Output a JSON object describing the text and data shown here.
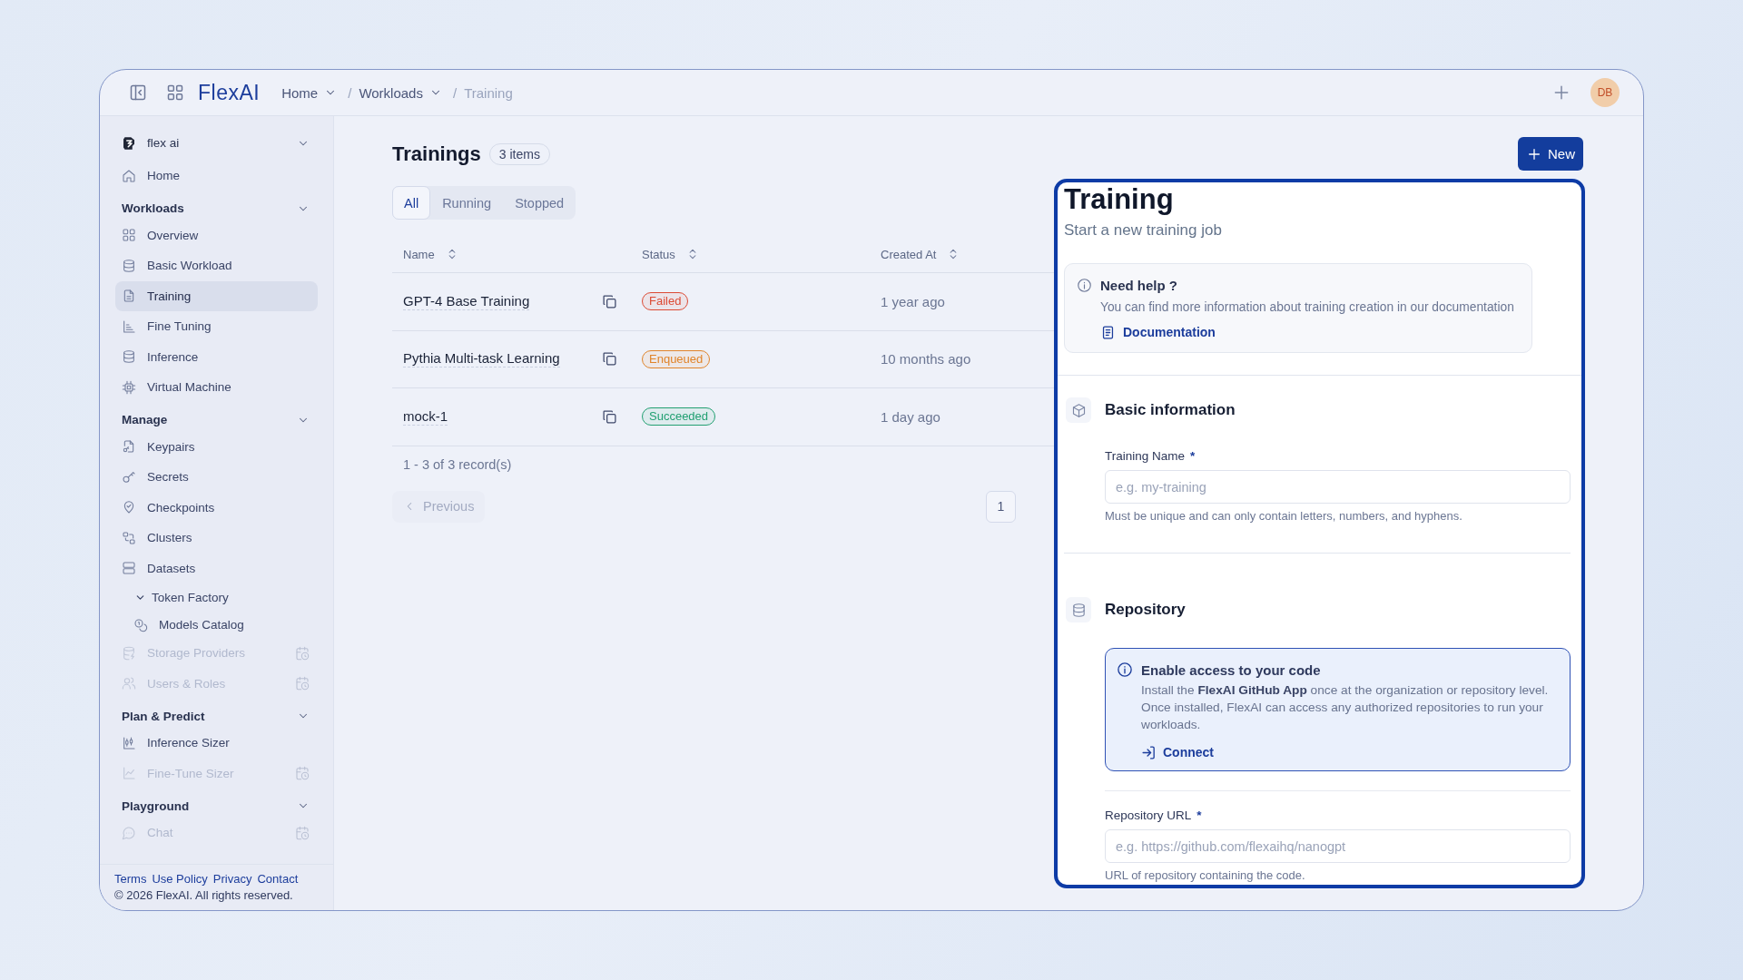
{
  "topbar": {
    "logo": "FlexAI",
    "breadcrumbs": {
      "separator": "/",
      "items": [
        {
          "label": "Home",
          "dropdown": true,
          "current": false
        },
        {
          "label": "Workloads",
          "dropdown": true,
          "current": false
        },
        {
          "label": "Training",
          "dropdown": false,
          "current": true
        }
      ]
    },
    "avatar": "DB"
  },
  "sidebar": {
    "workspace": "flex ai",
    "items": [
      {
        "kind": "link",
        "label": "Home",
        "selected": false,
        "disabled": false
      }
    ],
    "sections": [
      {
        "title": "Workloads",
        "expanded": true,
        "items": [
          {
            "kind": "link",
            "label": "Overview",
            "selected": false,
            "disabled": false
          },
          {
            "kind": "link",
            "label": "Basic Workload",
            "selected": false,
            "disabled": false
          },
          {
            "kind": "link",
            "label": "Training",
            "selected": true,
            "disabled": false
          },
          {
            "kind": "link",
            "label": "Fine Tuning",
            "selected": false,
            "disabled": false
          },
          {
            "kind": "link",
            "label": "Inference",
            "selected": false,
            "disabled": false
          },
          {
            "kind": "link",
            "label": "Virtual Machine",
            "selected": false,
            "disabled": false
          }
        ]
      },
      {
        "title": "Manage",
        "expanded": true,
        "items": [
          {
            "kind": "link",
            "label": "Keypairs",
            "selected": false,
            "disabled": false
          },
          {
            "kind": "link",
            "label": "Secrets",
            "selected": false,
            "disabled": false
          },
          {
            "kind": "link",
            "label": "Checkpoints",
            "selected": false,
            "disabled": false
          },
          {
            "kind": "link",
            "label": "Clusters",
            "selected": false,
            "disabled": false
          },
          {
            "kind": "link",
            "label": "Datasets",
            "selected": false,
            "disabled": false
          },
          {
            "kind": "group",
            "label": "Token Factory",
            "expanded": true,
            "children": [
              {
                "kind": "link",
                "label": "Models Catalog",
                "selected": false,
                "disabled": false
              }
            ]
          },
          {
            "kind": "link",
            "label": "Storage Providers",
            "selected": false,
            "disabled": true
          },
          {
            "kind": "link",
            "label": "Users & Roles",
            "selected": false,
            "disabled": true
          }
        ]
      },
      {
        "title": "Plan & Predict",
        "expanded": true,
        "items": [
          {
            "kind": "link",
            "label": "Inference Sizer",
            "selected": false,
            "disabled": false
          },
          {
            "kind": "link",
            "label": "Fine-Tune Sizer",
            "selected": false,
            "disabled": true
          }
        ]
      },
      {
        "title": "Playground",
        "expanded": true,
        "items": [
          {
            "kind": "link",
            "label": "Chat",
            "selected": false,
            "disabled": true
          }
        ]
      }
    ],
    "footer_links": [
      "Terms",
      "Use Policy",
      "Privacy",
      "Contact"
    ],
    "copyright": "© 2026 FlexAI. All rights reserved."
  },
  "page": {
    "title": "Trainings",
    "count": "3 items",
    "new_button": "New",
    "tabs": [
      {
        "label": "All",
        "selected": true
      },
      {
        "label": "Running",
        "selected": false
      },
      {
        "label": "Stopped",
        "selected": false
      }
    ],
    "table": {
      "columns": [
        "Name",
        "Status",
        "Created At"
      ],
      "rows": [
        {
          "name": "GPT-4 Base Training",
          "status": {
            "label": "Failed",
            "color": "#dc4a34"
          },
          "created_at": "1 year ago"
        },
        {
          "name": "Pythia Multi-task Learning",
          "status": {
            "label": "Enqueued",
            "color": "#e0842a"
          },
          "created_at": "10 months ago"
        },
        {
          "name": "mock-1",
          "status": {
            "label": "Succeeded",
            "color": "#22a072"
          },
          "created_at": "1 day ago"
        }
      ]
    },
    "records": "1 - 3 of 3 record(s)",
    "pagination": {
      "previous": {
        "label": "Previous",
        "disabled": true
      },
      "pages": [
        {
          "label": "1",
          "selected": true
        }
      ]
    }
  },
  "panel": {
    "title": "Training",
    "subtitle": "Start a new training job",
    "help": {
      "title": "Need help ?",
      "text": "You can find more information about training creation in our documentation",
      "link": "Documentation"
    },
    "sections": [
      {
        "title": "Basic information",
        "fields": [
          {
            "label": "Training Name",
            "required_mark": "*",
            "placeholder": "e.g. my-training",
            "hint": "Must be unique and can only contain letters, numbers, and hyphens."
          }
        ]
      },
      {
        "title": "Repository",
        "notice": {
          "title": "Enable access to your code",
          "text": "Install the **FlexAI GitHub App** once at the organization or repository level. Once installed, FlexAI can access any authorized repositories to run your workloads.",
          "link": "Connect"
        },
        "fields": [
          {
            "label": "Repository URL",
            "required_mark": "*",
            "placeholder": "e.g. https://github.com/flexaihq/nanogpt",
            "hint": "URL of repository containing the code."
          }
        ]
      }
    ]
  }
}
